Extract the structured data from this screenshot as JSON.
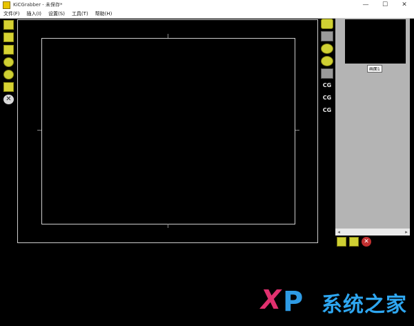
{
  "window": {
    "title": "KiCGrabber - 未保存*",
    "controls": [
      "—",
      "☐",
      "✕"
    ]
  },
  "menu": [
    "文件(F)",
    "插入(I)",
    "设置(S)",
    "工具(T)",
    "帮助(H)"
  ],
  "left_tools": [
    {
      "icon": "open-file-icon"
    },
    {
      "icon": "save-icon"
    },
    {
      "icon": "picture-icon"
    },
    {
      "icon": "circle-tool-icon"
    },
    {
      "icon": "circle-tool-icon"
    },
    {
      "icon": "text-icon"
    },
    {
      "icon": "close-icon",
      "glyph": "✕"
    }
  ],
  "right_tools": [
    {
      "icon": "target-icon"
    },
    {
      "icon": "resize-icon"
    },
    {
      "icon": "zoom-in-icon"
    },
    {
      "icon": "zoom-out-icon"
    },
    {
      "icon": "boot-icon"
    },
    {
      "icon": "cg-label-icon",
      "label": "CG"
    },
    {
      "icon": "cg-label-icon",
      "label": "CG"
    },
    {
      "icon": "cg-label-icon",
      "label": "CG"
    }
  ],
  "side_panel": {
    "thumbnail_label": "画面1"
  },
  "panel_tools": [
    {
      "icon": "add-page-icon"
    },
    {
      "icon": "film-icon"
    },
    {
      "icon": "delete-icon",
      "glyph": "✕"
    }
  ],
  "watermark": {
    "letters": [
      "X",
      "P"
    ],
    "text": "系统之家"
  },
  "colors": {
    "tool_yellow": "#cfd033",
    "canvas_bg": "#000000",
    "panel_gray": "#b4b4b4",
    "watermark_pink": "#e0306e",
    "watermark_blue": "#2e9be5"
  }
}
